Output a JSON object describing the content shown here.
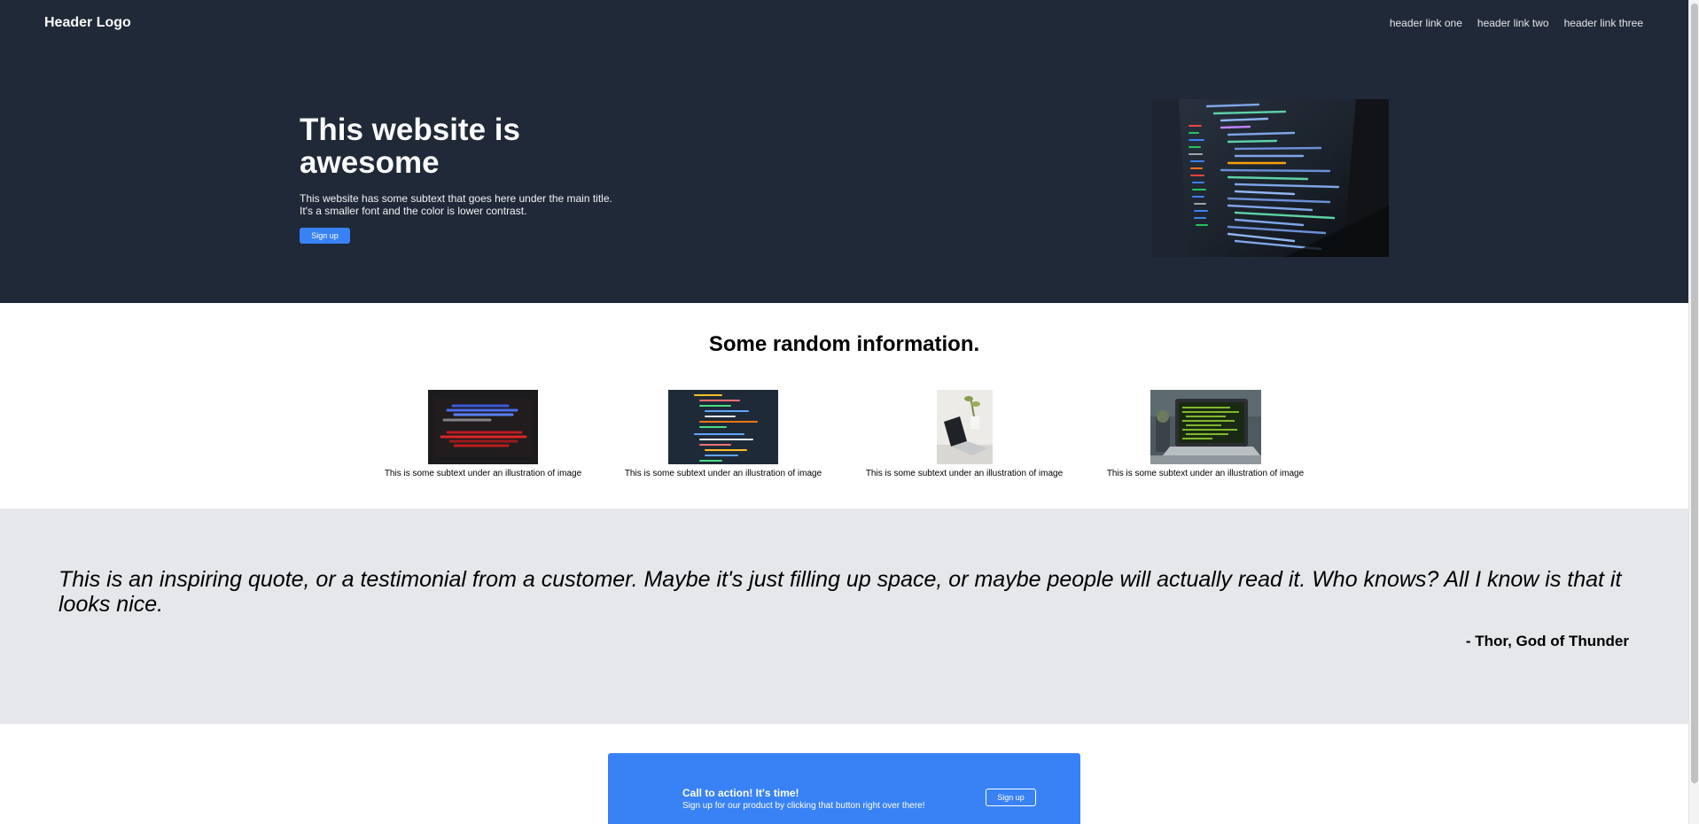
{
  "header": {
    "logo": "Header Logo",
    "links": [
      "header link one",
      "header link two",
      "header link three"
    ]
  },
  "hero": {
    "title": "This website is awesome",
    "subtext": "This website has some subtext that goes here under the main title. It's a smaller font and the color is lower contrast.",
    "button_label": "Sign up",
    "image_icon": "code-on-laptop-image"
  },
  "info": {
    "title": "Some random information.",
    "cards": [
      {
        "caption": "This is some subtext under an illustration of image",
        "image_icon": "red-blue-code-image"
      },
      {
        "caption": "This is some subtext under an illustration of image",
        "image_icon": "code-screen-image"
      },
      {
        "caption": "This is some subtext under an illustration of image",
        "image_icon": "laptop-plant-image"
      },
      {
        "caption": "This is some subtext under an illustration of image",
        "image_icon": "desk-laptop-image"
      }
    ]
  },
  "quote": {
    "text": "This is an inspiring quote, or a testimonial from a customer. Maybe it's just filling up space, or maybe people will actually read it. Who knows? All I know is that it looks nice.",
    "author": "- Thor, God of Thunder"
  },
  "cta": {
    "title": "Call to action! It's time!",
    "subtext": "Sign up for our product by clicking that button right over there!",
    "button_label": "Sign up"
  },
  "colors": {
    "hero_bg": "#1f2937",
    "accent": "#3882f6",
    "quote_bg": "#e5e7eb"
  }
}
